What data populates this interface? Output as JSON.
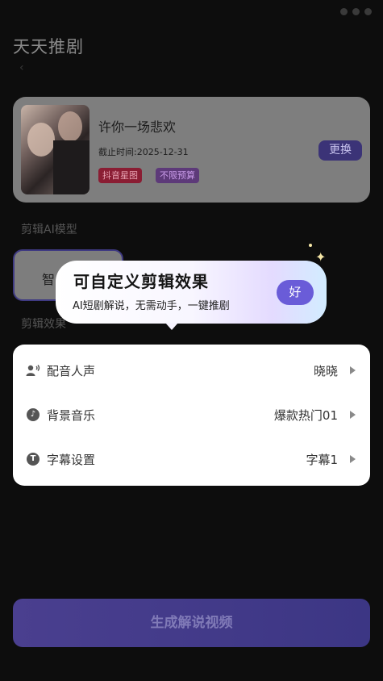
{
  "status_bar": {
    "time": "",
    "battery": ""
  },
  "app": {
    "title": "天天推剧",
    "subheader": ""
  },
  "drama": {
    "title": "许你一场悲欢",
    "deadline": "截止时间:2025-12-31",
    "tags": [
      "抖音星图",
      "不限预算"
    ],
    "change_label": "更换"
  },
  "model_section": {
    "label": "剪辑AI模型",
    "chip_label": "智"
  },
  "effect_section": {
    "label": "剪辑效果"
  },
  "tooltip": {
    "title": "可自定义剪辑效果",
    "description": "AI短剧解说，无需动手，一键推剧",
    "ok_label": "好"
  },
  "settings": {
    "rows": [
      {
        "label": "配音人声",
        "value": "晓晓",
        "icon": "voice-icon"
      },
      {
        "label": "背景音乐",
        "value": "爆款热门01",
        "icon": "music-icon"
      },
      {
        "label": "字幕设置",
        "value": "字幕1",
        "icon": "subtitle-icon"
      }
    ]
  },
  "generate_button": {
    "label": "生成解说视频"
  },
  "colors": {
    "accent": "#6a5cd8",
    "card_dim": "#7e7e7e",
    "tag_douyin": "#8a1d33",
    "tag_unlimited": "#5d3a79"
  }
}
